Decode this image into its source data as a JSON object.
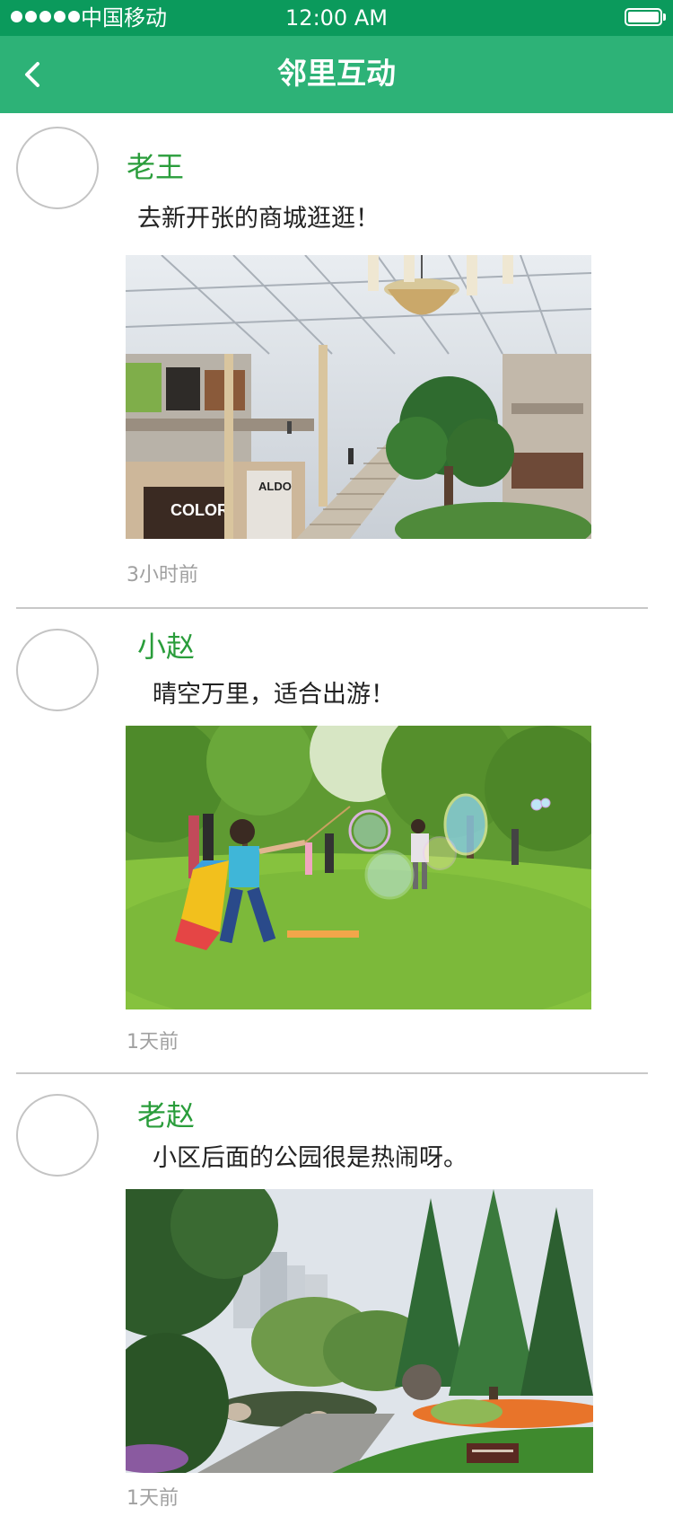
{
  "status_bar": {
    "carrier": "中国移动",
    "time": "12:00 AM"
  },
  "nav": {
    "title": "邻里互动"
  },
  "posts": [
    {
      "author": "老王",
      "content": "去新开张的商城逛逛！",
      "time_ago": "3小时前"
    },
    {
      "author": "小赵",
      "content": "晴空万里，适合出游！",
      "time_ago": "1天前"
    },
    {
      "author": "老赵",
      "content": "小区后面的公园很是热闹呀。",
      "time_ago": "1天前"
    }
  ],
  "colors": {
    "status_bar": "#0b9a5c",
    "nav_bar": "#2db277",
    "author_name": "#2a9d3b",
    "timestamp": "#a0a0a0"
  },
  "photo_store_signs": [
    "COLORI",
    "ALDO"
  ]
}
